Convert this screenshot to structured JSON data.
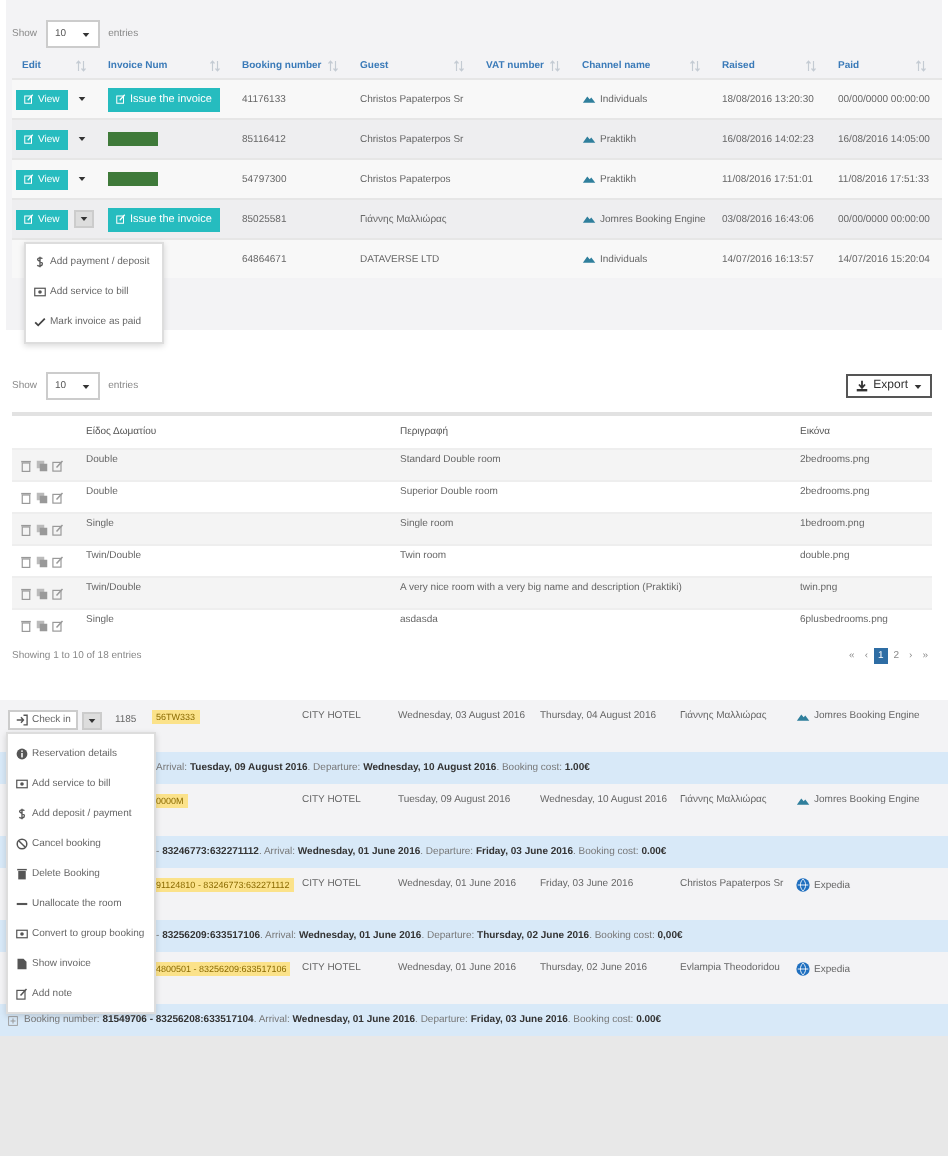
{
  "invoices": {
    "show_label": "Show",
    "page_size": "10",
    "entries_label": "entries",
    "columns": [
      "Edit",
      "Invoice Num",
      "Booking number",
      "Guest",
      "VAT number",
      "Channel name",
      "Raised",
      "Paid"
    ],
    "rows": [
      {
        "view": "View",
        "expanded": false,
        "invoice": {
          "kind": "button",
          "label": "Issue the invoice"
        },
        "booking": "41176133",
        "guest": "Christos Papaterpos Sr",
        "vat": "",
        "channel": "Individuals",
        "raised": "18/08/2016 13:20:30",
        "paid": "00/00/0000 00:00:00"
      },
      {
        "view": "View",
        "expanded": false,
        "invoice": {
          "kind": "redacted"
        },
        "booking": "85116412",
        "guest": "Christos Papaterpos Sr",
        "vat": "",
        "channel": "Praktikh",
        "raised": "16/08/2016 14:02:23",
        "paid": "16/08/2016 14:05:00"
      },
      {
        "view": "View",
        "expanded": false,
        "invoice": {
          "kind": "redacted"
        },
        "booking": "54797300",
        "guest": "Christos Papaterpos",
        "vat": "",
        "channel": "Praktikh",
        "raised": "11/08/2016 17:51:01",
        "paid": "11/08/2016 17:51:33"
      },
      {
        "view": "View",
        "expanded": true,
        "invoice": {
          "kind": "button",
          "label": "Issue the invoice"
        },
        "booking": "85025581",
        "guest": "Γιάννης Μαλλιώρας",
        "vat": "",
        "channel": "Jomres Booking Engine",
        "raised": "03/08/2016 16:43:06",
        "paid": "00/00/0000 00:00:00"
      },
      {
        "invoice": {
          "kind": "none"
        },
        "booking": "64864671",
        "guest": "DATAVERSE LTD",
        "vat": "",
        "channel": "Individuals",
        "raised": "14/07/2016 16:13:57",
        "paid": "14/07/2016 15:20:04"
      }
    ],
    "menu": [
      {
        "label": "Add payment / deposit"
      },
      {
        "label": "Add service to bill"
      },
      {
        "label": "Mark invoice as paid"
      }
    ]
  },
  "rooms": {
    "show_label": "Show",
    "page_size": "10",
    "entries_label": "entries",
    "export_label": "Export",
    "columns": [
      "Είδος Δωματίου",
      "Περιγραφή",
      "Εικόνα"
    ],
    "rows": [
      {
        "type": "Double",
        "description": "Standard Double room",
        "image": "2bedrooms.png"
      },
      {
        "type": "Double",
        "description": "Superior Double room",
        "image": "2bedrooms.png"
      },
      {
        "type": "Single",
        "description": "Single room",
        "image": "1bedroom.png"
      },
      {
        "type": "Twin/Double",
        "description": "Twin room",
        "image": "double.png"
      },
      {
        "type": "Twin/Double",
        "description": "A very nice room with a very big name and description (Praktiki)",
        "image": "twin.png"
      },
      {
        "type": "Single",
        "description": "asdasda",
        "image": "6plusbedrooms.png"
      }
    ],
    "info": "Showing 1 to 10 of 18 entries",
    "pages": [
      {
        "label": "«",
        "selected": false
      },
      {
        "label": "‹",
        "selected": false
      },
      {
        "label": "1",
        "selected": true
      },
      {
        "label": "2",
        "selected": false
      },
      {
        "label": "›",
        "selected": false
      },
      {
        "label": "»",
        "selected": false
      }
    ]
  },
  "bookings": {
    "check_in_label": "Check in",
    "menu_open": true,
    "rows": [
      {
        "kind": "booking",
        "id": "1185",
        "tag": "56TW333",
        "hotel": "CITY HOTEL",
        "arrival": "Wednesday, 03 August 2016",
        "departure": "Thursday, 04 August 2016",
        "guest": "Γιάννης Μαλλιώρας",
        "channel": "Jomres Booking Engine"
      },
      {
        "kind": "summary",
        "toggle": false,
        "text": "Arrival: **Tuesday, 09 August 2016**. Departure: **Wednesday, 10 August 2016**. Booking cost: **1.00€**"
      },
      {
        "kind": "booking",
        "tag": "0000M",
        "hotel": "CITY HOTEL",
        "arrival": "Tuesday, 09 August 2016",
        "departure": "Wednesday, 10 August 2016",
        "guest": "Γιάννης Μαλλιώρας",
        "channel": "Jomres Booking Engine"
      },
      {
        "kind": "summary",
        "toggle": false,
        "text": "- **83246773:632271112**. Arrival: **Wednesday, 01 June 2016**. Departure: **Friday, 03 June 2016**. Booking cost: **0.00€**"
      },
      {
        "kind": "booking",
        "tag": "91124810 - 83246773:632271112",
        "hotel": "CITY HOTEL",
        "arrival": "Wednesday, 01 June 2016",
        "departure": "Friday, 03 June 2016",
        "guest": "Christos Papaterpos Sr",
        "channel": "Expedia"
      },
      {
        "kind": "summary",
        "toggle": false,
        "text": "- **83256209:633517106**. Arrival: **Wednesday, 01 June 2016**. Departure: **Thursday, 02 June 2016**. Booking cost: **0,00€**"
      },
      {
        "kind": "booking",
        "tag": "4800501 - 83256209:633517106",
        "hotel": "CITY HOTEL",
        "arrival": "Wednesday, 01 June 2016",
        "departure": "Thursday, 02 June 2016",
        "guest": "Evlampia Theodoridou",
        "channel": "Expedia"
      },
      {
        "kind": "summary",
        "toggle": true,
        "text": "Booking number: **81549706 - 83256208:633517104**. Arrival: **Wednesday, 01 June 2016**. Departure: **Friday, 03 June 2016**. Booking cost: **0.00€**"
      }
    ],
    "menu": [
      {
        "label": "Reservation details"
      },
      {
        "label": "Add service to bill"
      },
      {
        "label": "Add deposit / payment"
      },
      {
        "label": "Cancel booking"
      },
      {
        "label": "Delete Booking"
      },
      {
        "label": "Unallocate the room"
      },
      {
        "label": "Convert to group booking"
      },
      {
        "label": "Show invoice"
      },
      {
        "label": "Add note"
      }
    ]
  }
}
